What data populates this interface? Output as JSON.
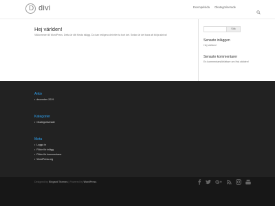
{
  "header": {
    "logo_text": "divi",
    "logo_mark": "D",
    "nav": [
      {
        "label": "Exempelsida"
      },
      {
        "label": "Okategoriserade"
      }
    ]
  },
  "main": {
    "post": {
      "title": "Hej världen!",
      "excerpt": "Välkommen till WordPress. Detta är ditt första inlägg. Du kan redigera det eller ta bort det. Sedan är det bara att börja skriva!"
    },
    "sidebar": {
      "search_button": "Sök",
      "recent_posts_title": "Senaste inläggen",
      "recent_posts": [
        "Hej världen!"
      ],
      "recent_comments_title": "Senaste kommentarer",
      "recent_comment": "En kommentarsförfattare om Hej världen!"
    }
  },
  "footer": {
    "archive_title": "Arkiv",
    "archive_items": [
      "december 2019"
    ],
    "categories_title": "Kategorier",
    "categories_items": [
      "Okategoriserade"
    ],
    "meta_title": "Meta",
    "meta_items": [
      "Logga in",
      "Flöde för inlägg",
      "Flöde för kommentarer",
      "WordPress.org"
    ]
  },
  "bottom_bar": {
    "credits_prefix": "Designed by",
    "credits_author": "Elegant Themes",
    "credits_separator": "| Powered by",
    "credits_platform": "WordPress",
    "social_icons": [
      "facebook-icon",
      "twitter-icon",
      "google-plus-icon",
      "rss-icon",
      "instagram-icon",
      "youtube-icon"
    ]
  },
  "colors": {
    "accent": "#2ea3f2",
    "footer_bg": "#222222",
    "bottom_bar_bg": "#171717"
  }
}
